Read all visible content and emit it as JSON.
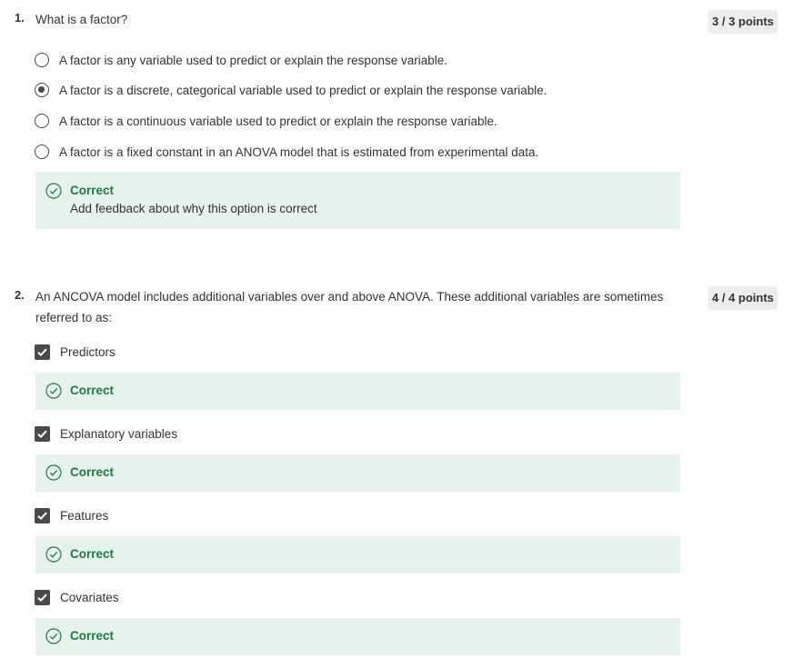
{
  "questions": [
    {
      "number": "1.",
      "text": "What is a factor?",
      "points": "3 / 3 points",
      "type": "radio",
      "options": [
        {
          "label": "A factor is any variable used to predict or explain the response variable.",
          "selected": false
        },
        {
          "label": "A factor is a discrete, categorical variable used to predict or explain the response variable.",
          "selected": true
        },
        {
          "label": "A factor is a continuous variable used to predict or explain the response variable.",
          "selected": false
        },
        {
          "label": "A factor is a fixed constant in an ANOVA model that is estimated from experimental data.",
          "selected": false
        }
      ],
      "feedback": {
        "title": "Correct",
        "body": "Add feedback about why this option is correct"
      }
    },
    {
      "number": "2.",
      "text": "An ANCOVA model includes additional variables over and above ANOVA. These additional variables are sometimes referred to as:",
      "points": "4 / 4 points",
      "type": "checkbox",
      "options": [
        {
          "label": "Predictors",
          "checked": true,
          "feedback": "Correct"
        },
        {
          "label": "Explanatory variables",
          "checked": true,
          "feedback": "Correct"
        },
        {
          "label": "Features",
          "checked": true,
          "feedback": "Correct"
        },
        {
          "label": "Covariates",
          "checked": true,
          "feedback": "Correct"
        }
      ]
    }
  ],
  "colors": {
    "correct_text": "#1f7a44",
    "feedback_bg": "#e6f2ec",
    "badge_bg": "#ededed",
    "control": "#4a4a4a"
  },
  "icons": {
    "correct": "check-circle-icon",
    "checkbox": "checkmark-icon",
    "radio": "radio-icon"
  }
}
